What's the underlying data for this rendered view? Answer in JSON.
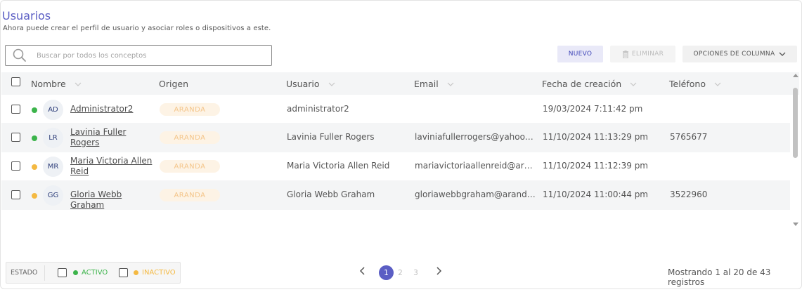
{
  "header": {
    "title": "Usuarios",
    "subtitle": "Ahora puede crear el perfil de usuario y asociar roles o dispositivos a este."
  },
  "search": {
    "placeholder": "Buscar por todos los conceptos",
    "value": ""
  },
  "toolbar": {
    "new_label": "NUEVO",
    "delete_label": "ELIMINAR",
    "columns_label": "OPCIONES DE COLUMNA"
  },
  "table": {
    "columns": {
      "name": "Nombre",
      "origin": "Origen",
      "user": "Usuario",
      "email": "Email",
      "created": "Fecha de creación",
      "phone": "Teléfono"
    },
    "rows": [
      {
        "status": "active",
        "initials": "AD",
        "name": "Administrator2",
        "origin": "ARANDA",
        "user": "administrator2",
        "email": "",
        "created": "19/03/2024 7:11:42 pm",
        "phone": ""
      },
      {
        "status": "active",
        "initials": "LR",
        "name": "Lavinia Fuller Rogers",
        "origin": "ARANDA",
        "user": "Lavinia Fuller Rogers",
        "email": "laviniafullerrogers@yahoo.es",
        "created": "11/10/2024 11:13:29 pm",
        "phone": "5765677"
      },
      {
        "status": "inactive",
        "initials": "MR",
        "name": "Maria Victoria Allen Reid",
        "origin": "ARANDA",
        "user": "Maria Victoria Allen Reid",
        "email": "mariavictoriaallenreid@aran...",
        "created": "11/10/2024 11:12:39 pm",
        "phone": ""
      },
      {
        "status": "inactive",
        "initials": "GG",
        "name": "Gloria Webb Graham",
        "origin": "ARANDA",
        "user": "Gloria Webb Graham",
        "email": "gloriawebbgraham@arandas...",
        "created": "11/10/2024 11:00:44 pm",
        "phone": "3522960"
      }
    ]
  },
  "legend": {
    "status_label": "ESTADO",
    "active_label": "ACTIVO",
    "inactive_label": "INACTIVO"
  },
  "pagination": {
    "pages": [
      "1",
      "2",
      "3"
    ],
    "current": "1",
    "summary": "Mostrando 1 al 20 de 43 registros"
  },
  "colors": {
    "accent": "#5b5ec4",
    "active": "#3cb44b",
    "inactive": "#f4b942",
    "badge_text": "#f4c58a",
    "badge_bg": "#fdf3e5"
  },
  "icons": {
    "search": "search-icon",
    "delete": "trash-icon",
    "columns": "chevron-down-icon",
    "sort": "chevron-down-icon",
    "prev": "chevron-left-icon",
    "next": "chevron-right-icon"
  }
}
